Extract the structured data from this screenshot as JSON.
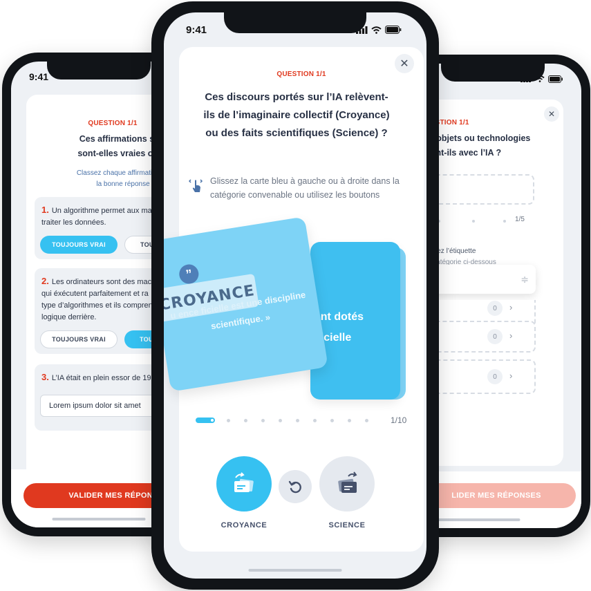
{
  "left_phone": {
    "time": "9:41",
    "question_label": "QUESTION 1/1",
    "title_line1": "Ces affirmations suiv",
    "title_line2": "sont-elles vraies ou fa",
    "subtitle_line1": "Classez chaque affirmation en",
    "subtitle_line2": "la bonne réponse",
    "items": [
      {
        "number": "1.",
        "text_line1": "Un algorithme permet aux mac",
        "text_line2": "traiter les données.",
        "btn_true": "TOUJOURS VRAI",
        "btn_other": "TOU"
      },
      {
        "number": "2.",
        "text_line1": "Les ordinateurs sont des mach",
        "text_line2": "qui éxécutent parfaitement et ra",
        "text_line3": "type d’algorithmes et ils compren",
        "text_line4": "logique derrière.",
        "btn_true": "TOUJOURS VRAI",
        "btn_other": "TOU"
      },
      {
        "number": "3.",
        "text_line1": "L’IA était en plein essor de 195",
        "input_value": "Lorem ipsum dolor sit amet"
      }
    ],
    "validate_label": "VALIDER MES RÉPONS"
  },
  "right_phone": {
    "question_label": "QUESTION 1/1",
    "title_line1": "s, ces objets ou technologies",
    "title_line2": "tionnent-ils avec l’IA ?",
    "progress_count": "1/5",
    "instr_line1": "ez ou glissez l’étiquette",
    "instr_line2": "la bonne catégorie ci-dessous",
    "badges": [
      "0",
      "0",
      "0"
    ],
    "validate_label": "LIDER MES RÉPONSES"
  },
  "center_phone": {
    "time": "9:41",
    "question_label": "QUESTION 1/1",
    "title": "Ces discours portés sur l’IA relèvent-ils de l’imaginaire collectif (Croyance) ou des faits scientifiques (Science) ?",
    "instruction": "Glissez la carte bleu à gauche ou à droite dans la catégorie convenable ou utilisez les boutons",
    "back_card_text": "ont dotés ificielle",
    "front_card_text": "u ence ficielle est une discipline scientifique. »",
    "drop_label": "CROYANCE",
    "progress_count": "1/10",
    "btn_croyance_label": "CROYANCE",
    "btn_science_label": "SCIENCE"
  },
  "colors": {
    "accent_blue": "#36c1f1",
    "accent_red": "#e0391f",
    "validate_disabled": "#f6b5ab"
  },
  "icons": [
    "close-icon",
    "swipe-hand-icon",
    "quote-icon",
    "undo-icon",
    "croyance-card-icon",
    "science-card-icon",
    "chevron-right-icon",
    "drag-handle-icon"
  ]
}
